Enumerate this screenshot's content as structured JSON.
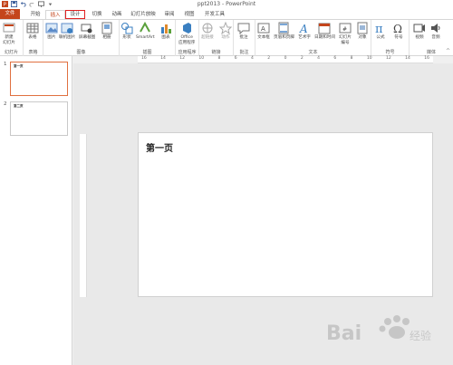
{
  "window": {
    "title": "ppt2013 - PowerPoint"
  },
  "tabs": [
    {
      "label": "文件"
    },
    {
      "label": "开始"
    },
    {
      "label": "插入"
    },
    {
      "label": "设计"
    },
    {
      "label": "切换"
    },
    {
      "label": "动画"
    },
    {
      "label": "幻灯片放映"
    },
    {
      "label": "审阅"
    },
    {
      "label": "视图"
    },
    {
      "label": "开发工具"
    }
  ],
  "active_tab": "插入",
  "highlighted_tab": "设计",
  "ribbon": {
    "groups": [
      {
        "label": "幻灯片",
        "buttons": [
          "新建\n幻灯片"
        ]
      },
      {
        "label": "表格",
        "buttons": [
          "表格"
        ]
      },
      {
        "label": "图像",
        "buttons": [
          "图片",
          "联机图片",
          "屏幕截图",
          "相册"
        ]
      },
      {
        "label": "插图",
        "buttons": [
          "形状",
          "SmartArt",
          "图表"
        ]
      },
      {
        "label": "应用程序",
        "buttons": [
          "Office\n应用程序"
        ]
      },
      {
        "label": "链接",
        "buttons": [
          "超链接",
          "动作"
        ]
      },
      {
        "label": "批注",
        "buttons": [
          "批注"
        ]
      },
      {
        "label": "文本",
        "buttons": [
          "文本框",
          "页眉和页脚",
          "艺术字",
          "日期和时间",
          "幻灯片\n编号",
          "对象"
        ]
      },
      {
        "label": "符号",
        "buttons": [
          "公式",
          "符号"
        ]
      },
      {
        "label": "媒体",
        "buttons": [
          "视频",
          "音频"
        ]
      }
    ]
  },
  "ruler": {
    "numbers": [
      "16",
      "14",
      "12",
      "10",
      "8",
      "6",
      "4",
      "2",
      "0",
      "2",
      "4",
      "6",
      "8",
      "10",
      "12",
      "14",
      "16"
    ]
  },
  "slides": [
    {
      "number": "1",
      "text": "第一页"
    },
    {
      "number": "2",
      "text": "第二页"
    }
  ],
  "slide": {
    "title": "第一页"
  },
  "colors": {
    "accent": "#c4451c",
    "highlight": "#e02020",
    "selected_thumb_border": "#e07040"
  }
}
